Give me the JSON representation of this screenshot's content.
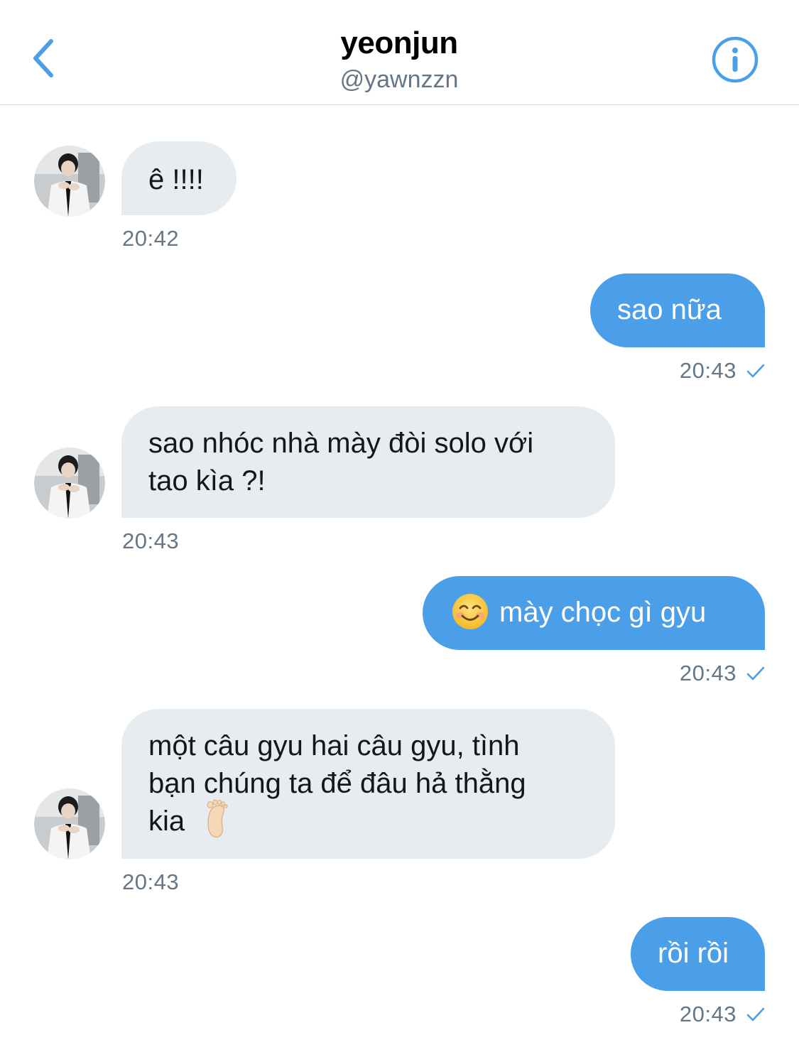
{
  "header": {
    "title": "yeonjun",
    "handle": "@yawnzzn",
    "back_icon": "chevron-left-icon",
    "info_icon": "info-icon"
  },
  "colors": {
    "accent": "#4a9fe8",
    "received_bubble": "#e6ecf0",
    "muted_text": "#657786"
  },
  "messages": [
    {
      "direction": "received",
      "text": "ê !!!!",
      "time": "20:42"
    },
    {
      "direction": "sent",
      "text": "sao nữa",
      "time": "20:43"
    },
    {
      "direction": "received",
      "line1": "sao nhóc nhà mày đòi solo với",
      "line2": "tao kìa ?!",
      "time": "20:43"
    },
    {
      "direction": "sent",
      "emoji": "smiling-face-icon",
      "text": "mày chọc gì gyu",
      "time": "20:43"
    },
    {
      "direction": "received",
      "line1": "một câu gyu hai câu gyu, tình",
      "line2": "bạn chúng ta để đâu hả thằng",
      "line3": "kia",
      "emoji": "foot-icon",
      "time": "20:43"
    },
    {
      "direction": "sent",
      "text": "rồi rồi",
      "time": "20:43"
    }
  ]
}
